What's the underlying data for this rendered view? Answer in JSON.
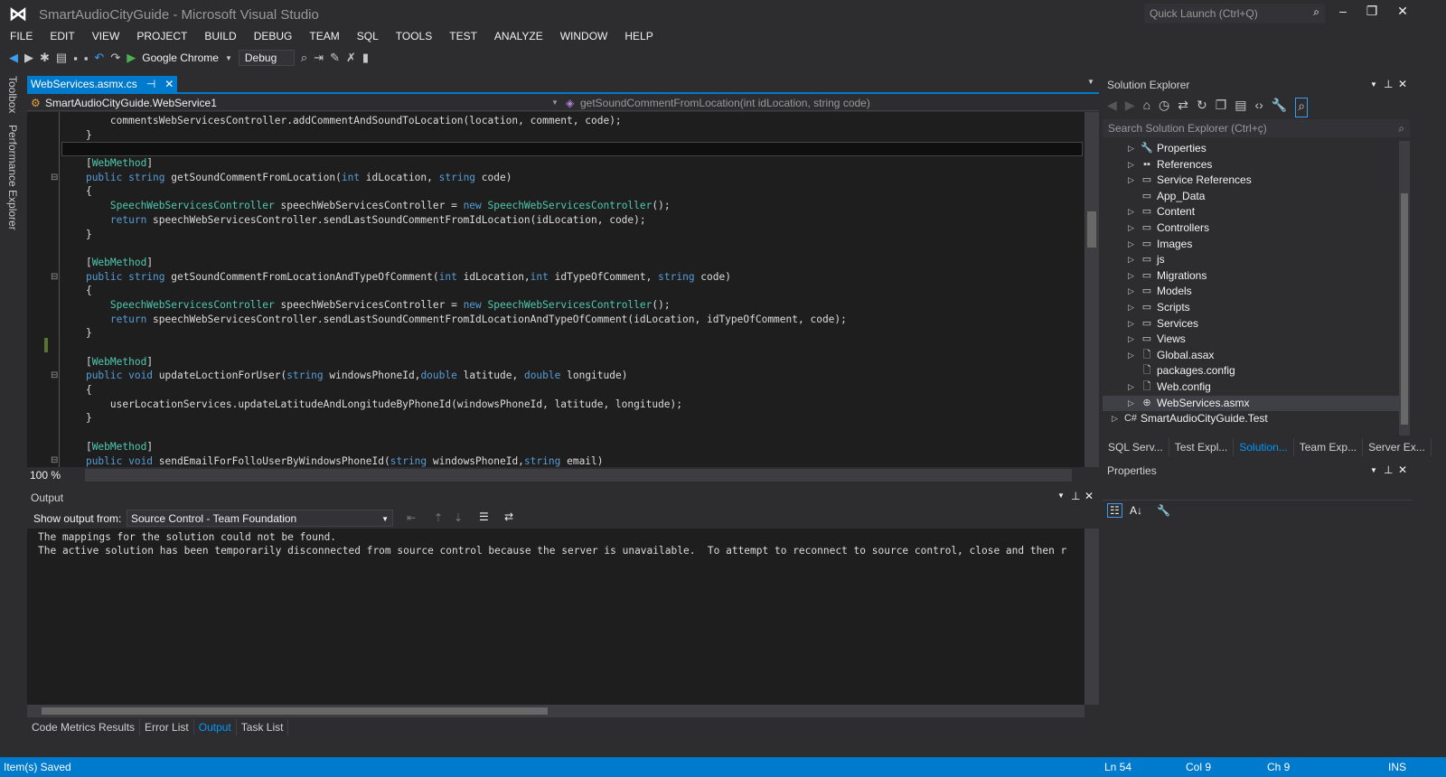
{
  "window": {
    "title": "SmartAudioCityGuide - Microsoft Visual Studio",
    "quick_launch": "Quick Launch (Ctrl+Q)"
  },
  "menu": [
    "FILE",
    "EDIT",
    "VIEW",
    "PROJECT",
    "BUILD",
    "DEBUG",
    "TEAM",
    "SQL",
    "TOOLS",
    "TEST",
    "ANALYZE",
    "WINDOW",
    "HELP"
  ],
  "toolbar": {
    "run_target": "Google Chrome",
    "configuration": "Debug"
  },
  "side_tabs": {
    "toolbox": "Toolbox",
    "performance": "Performance Explorer"
  },
  "editor": {
    "tab": "WebServices.asmx.cs",
    "class_nav": "SmartAudioCityGuide.WebService1",
    "member_nav": "getSoundCommentFromLocation(int idLocation, string code)",
    "zoom": "100 %",
    "lines": [
      [
        [
          "        commentsWebServicesController.addCommentAndSoundToLocation(location, comment, code);",
          "tx"
        ]
      ],
      [
        [
          "    }",
          "tx"
        ]
      ],
      [],
      [
        [
          "    [",
          "tx"
        ],
        [
          "WebMethod",
          "at"
        ],
        [
          "]",
          "tx"
        ]
      ],
      [
        [
          "    ",
          "tx"
        ],
        [
          "public string ",
          "kw"
        ],
        [
          "getSoundCommentFromLocation(",
          "tx"
        ],
        [
          "int ",
          "kw"
        ],
        [
          "idLocation, ",
          "tx"
        ],
        [
          "string ",
          "kw"
        ],
        [
          "code)",
          "tx"
        ]
      ],
      [
        [
          "    {",
          "tx"
        ]
      ],
      [
        [
          "        ",
          "tx"
        ],
        [
          "SpeechWebServicesController ",
          "ty"
        ],
        [
          "speechWebServicesController = ",
          "tx"
        ],
        [
          "new ",
          "kw"
        ],
        [
          "SpeechWebServicesController",
          "ty"
        ],
        [
          "();",
          "tx"
        ]
      ],
      [
        [
          "        ",
          "tx"
        ],
        [
          "return ",
          "kw"
        ],
        [
          "speechWebServicesController.sendLastSoundCommentFromIdLocation(idLocation, code);",
          "tx"
        ]
      ],
      [
        [
          "    }",
          "tx"
        ]
      ],
      [],
      [
        [
          "    [",
          "tx"
        ],
        [
          "WebMethod",
          "at"
        ],
        [
          "]",
          "tx"
        ]
      ],
      [
        [
          "    ",
          "tx"
        ],
        [
          "public string ",
          "kw"
        ],
        [
          "getSoundCommentFromLocationAndTypeOfComment(",
          "tx"
        ],
        [
          "int ",
          "kw"
        ],
        [
          "idLocation,",
          "tx"
        ],
        [
          "int ",
          "kw"
        ],
        [
          "idTypeOfComment, ",
          "tx"
        ],
        [
          "string ",
          "kw"
        ],
        [
          "code)",
          "tx"
        ]
      ],
      [
        [
          "    {",
          "tx"
        ]
      ],
      [
        [
          "        ",
          "tx"
        ],
        [
          "SpeechWebServicesController ",
          "ty"
        ],
        [
          "speechWebServicesController = ",
          "tx"
        ],
        [
          "new ",
          "kw"
        ],
        [
          "SpeechWebServicesController",
          "ty"
        ],
        [
          "();",
          "tx"
        ]
      ],
      [
        [
          "        ",
          "tx"
        ],
        [
          "return ",
          "kw"
        ],
        [
          "speechWebServicesController.sendLastSoundCommentFromIdLocationAndTypeOfComment(idLocation, idTypeOfComment, code);",
          "tx"
        ]
      ],
      [
        [
          "    }",
          "tx"
        ]
      ],
      [],
      [
        [
          "    [",
          "tx"
        ],
        [
          "WebMethod",
          "at"
        ],
        [
          "]",
          "tx"
        ]
      ],
      [
        [
          "    ",
          "tx"
        ],
        [
          "public void ",
          "kw"
        ],
        [
          "updateLoctionForUser(",
          "tx"
        ],
        [
          "string ",
          "kw"
        ],
        [
          "windowsPhoneId,",
          "tx"
        ],
        [
          "double ",
          "kw"
        ],
        [
          "latitude, ",
          "tx"
        ],
        [
          "double ",
          "kw"
        ],
        [
          "longitude)",
          "tx"
        ]
      ],
      [
        [
          "    {",
          "tx"
        ]
      ],
      [
        [
          "        userLocationServices.updateLatitudeAndLongitudeByPhoneId(windowsPhoneId, latitude, longitude);",
          "tx"
        ]
      ],
      [
        [
          "    }",
          "tx"
        ]
      ],
      [],
      [
        [
          "    [",
          "tx"
        ],
        [
          "WebMethod",
          "at"
        ],
        [
          "]",
          "tx"
        ]
      ],
      [
        [
          "    ",
          "tx"
        ],
        [
          "public void ",
          "kw"
        ],
        [
          "sendEmailForFolloUserByWindowsPhoneId(",
          "tx"
        ],
        [
          "string ",
          "kw"
        ],
        [
          "windowsPhoneId,",
          "tx"
        ],
        [
          "string ",
          "kw"
        ],
        [
          "email)",
          "tx"
        ]
      ]
    ]
  },
  "output": {
    "title": "Output",
    "show_from_label": "Show output from:",
    "source": "Source Control - Team Foundation",
    "text": "The mappings for the solution could not be found.\nThe active solution has been temporarily disconnected from source control because the server is unavailable.  To attempt to reconnect to source control, close and then r"
  },
  "bottom_tabs": [
    {
      "label": "Code Metrics Results"
    },
    {
      "label": "Error List"
    },
    {
      "label": "Output",
      "active": true
    },
    {
      "label": "Task List"
    }
  ],
  "solution_explorer": {
    "title": "Solution Explorer",
    "search_placeholder": "Search Solution Explorer (Ctrl+ç)",
    "items": [
      {
        "label": "Properties",
        "icon": "wrench-icon",
        "expandable": true
      },
      {
        "label": "References",
        "icon": "references-icon",
        "expandable": true
      },
      {
        "label": "Service References",
        "icon": "folder-icon",
        "expandable": true
      },
      {
        "label": "App_Data",
        "icon": "folder-icon",
        "expandable": false
      },
      {
        "label": "Content",
        "icon": "folder-icon",
        "expandable": true
      },
      {
        "label": "Controllers",
        "icon": "folder-icon",
        "expandable": true
      },
      {
        "label": "Images",
        "icon": "folder-icon",
        "expandable": true
      },
      {
        "label": "js",
        "icon": "folder-icon",
        "expandable": true
      },
      {
        "label": "Migrations",
        "icon": "folder-icon",
        "expandable": true
      },
      {
        "label": "Models",
        "icon": "folder-icon",
        "expandable": true
      },
      {
        "label": "Scripts",
        "icon": "folder-icon",
        "expandable": true
      },
      {
        "label": "Services",
        "icon": "folder-icon",
        "expandable": true
      },
      {
        "label": "Views",
        "icon": "folder-icon",
        "expandable": true
      },
      {
        "label": "Global.asax",
        "icon": "file-icon",
        "expandable": true
      },
      {
        "label": "packages.config",
        "icon": "file-icon",
        "expandable": false
      },
      {
        "label": "Web.config",
        "icon": "file-icon",
        "expandable": true
      },
      {
        "label": "WebServices.asmx",
        "icon": "webservice-icon",
        "expandable": true,
        "selected": true
      },
      {
        "label": "SmartAudioCityGuide.Test",
        "icon": "csharp-project-icon",
        "expandable": true,
        "level": 0
      }
    ],
    "tabs": [
      {
        "label": "SQL Serv..."
      },
      {
        "label": "Test Expl..."
      },
      {
        "label": "Solution...",
        "active": true
      },
      {
        "label": "Team Exp..."
      },
      {
        "label": "Server Ex..."
      }
    ]
  },
  "properties": {
    "title": "Properties"
  },
  "status": {
    "message": "Item(s) Saved",
    "line": "Ln 54",
    "col": "Col 9",
    "ch": "Ch 9",
    "mode": "INS"
  },
  "colors": {
    "accent": "#007acc",
    "background": "#2d2d30",
    "editor": "#1e1e1e"
  }
}
